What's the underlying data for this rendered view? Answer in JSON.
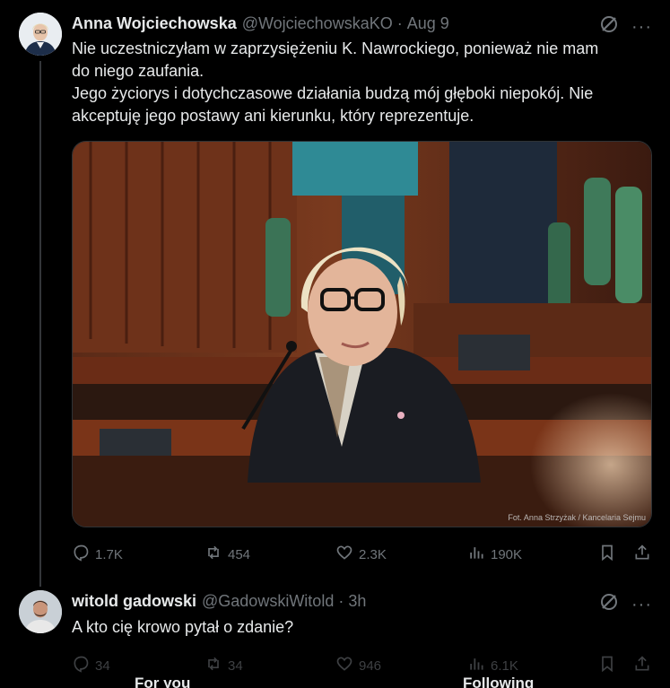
{
  "tweet1": {
    "name": "Anna Wojciechowska",
    "handle": "@WojciechowskaKO",
    "dot": "·",
    "time": "Aug 9",
    "text_lines": [
      "Nie uczestniczyłam w zaprzysiężeniu K. Nawrockiego, ponieważ nie mam",
      "do niego zaufania.",
      "Jego życiorys i dotychczasowe działania budzą mój głęboki niepokój. Nie",
      "akceptuję jego postawy ani kierunku, który reprezentuje."
    ],
    "photo_credit": "Fot. Anna Strzyżak / Kancelaria Sejmu",
    "replies": "1.7K",
    "reposts": "454",
    "likes": "2.3K",
    "views": "190K"
  },
  "tweet2": {
    "name": "witold gadowski",
    "handle": "@GadowskiWitold",
    "dot": "·",
    "time": "3h",
    "text": "A kto cię krowo pytał o zdanie?",
    "replies": "34",
    "reposts": "34",
    "likes": "946",
    "views": "6.1K"
  },
  "icons": {
    "more": "···",
    "grok": "grok-icon",
    "reply": "reply-icon",
    "repost": "repost-icon",
    "like": "heart-icon",
    "views": "views-icon",
    "bookmark": "bookmark-icon",
    "share": "share-icon"
  },
  "tabs": {
    "for_you": "For you",
    "following": "Following"
  },
  "colors": {
    "background": "#000000",
    "text": "#e7e9ea",
    "muted": "#71767b",
    "divider": "#2f3336"
  }
}
